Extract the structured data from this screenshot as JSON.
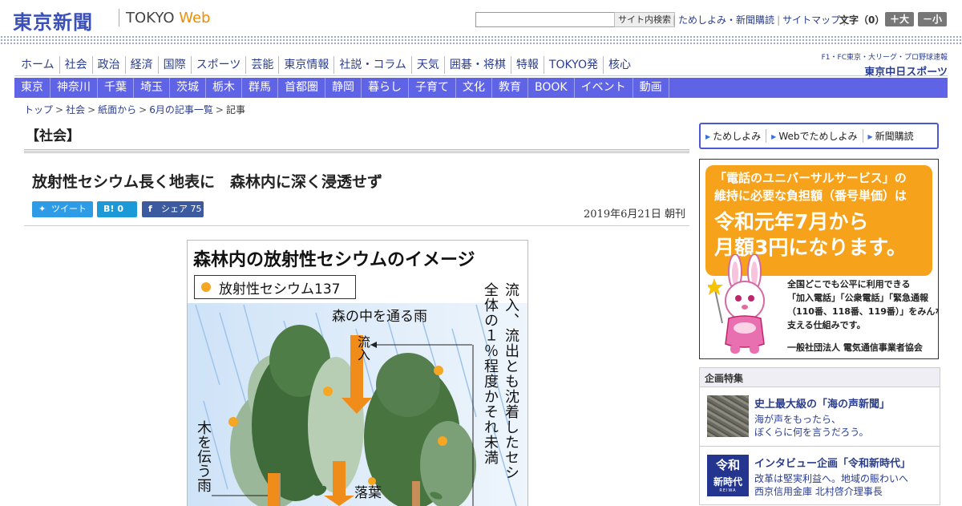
{
  "header": {
    "logo": "東京新聞",
    "logo_sub_plain": "TOKYO ",
    "logo_sub_accent": "Web",
    "search": {
      "placeholder": "",
      "button": "サイト内検索"
    },
    "links": [
      "ためしよみ・新聞購読",
      "サイトマップ"
    ],
    "text_size_label": "文字（0）",
    "size_up": "＋大",
    "size_down": "－小"
  },
  "nav_main": [
    "ホーム",
    "社会",
    "政治",
    "経済",
    "国際",
    "スポーツ",
    "芸能",
    "東京情報",
    "社説・コラム",
    "天気",
    "囲碁・将棋",
    "特報",
    "TOKYO発",
    "核心"
  ],
  "nav_sub": [
    "東京",
    "神奈川",
    "千葉",
    "埼玉",
    "茨城",
    "栃木",
    "群馬",
    "首都圏",
    "静岡",
    "暮らし",
    "子育て",
    "文化",
    "教育",
    "BOOK",
    "イベント",
    "動画"
  ],
  "chunichi": {
    "tagline": "F1・FC東京・大リーグ・プロ野球速報",
    "name": "東京中日スポーツ"
  },
  "breadcrumb": [
    "トップ",
    "社会",
    "紙面から",
    "6月の記事一覧",
    "記事"
  ],
  "article": {
    "section": "【社会】",
    "title": "放射性セシウム長く地表に　森林内に深く浸透せず",
    "share": {
      "tweet": "ツイート",
      "hatena": "0",
      "facebook": "シェア",
      "facebook_count": "75"
    },
    "date": "2019年6月21日 朝刊"
  },
  "figure": {
    "title": "森林内の放射性セシウムのイメージ",
    "legend": "放射性セシウム137",
    "rain_forest": "森の中を通る雨",
    "inflow": "流入",
    "vertical_note": "流入、流出とも沈着したセシ",
    "vertical_note2": "全体の１％程度かそれ未満",
    "trunk_rain": "木を伝う雨",
    "leaf_fall": "落葉",
    "colors": {
      "cesium": "#f5a623",
      "arrow": "#f08c1a",
      "tree": "#3f6b3a"
    }
  },
  "sidebar": {
    "menu": [
      "ためしよみ",
      "Webでためしよみ",
      "新聞購読"
    ],
    "ad": {
      "line1": "「電話のユニバーサルサービス」の",
      "line2": "維持に必要な負担額（番号単価）は",
      "line3": "令和元年7月から",
      "line4": "月額3円になります。",
      "body1": "全国どこでも公平に利用できる",
      "body2": "「加入電話」「公衆電話」「緊急通報",
      "body3": "（110番、118番、119番）」をみんなで",
      "body4": "支える仕組みです。",
      "org": "一般社団法人 電気通信事業者協会"
    },
    "feature": {
      "heading": "企画特集",
      "items": [
        {
          "title": "史上最大級の「海の声新聞」",
          "desc1": "海が声をもったら、",
          "desc2": "ぼくらに何を言うだろう。"
        },
        {
          "title": "インタビュー企画「令和新時代」",
          "desc1": "改革は堅実利益へ。地域の賑わいへ",
          "desc2": "西京信用金庫 北村啓介理事長",
          "thumb1": "令和",
          "thumb2": "新時代",
          "thumb3": "REIWA"
        }
      ]
    }
  }
}
